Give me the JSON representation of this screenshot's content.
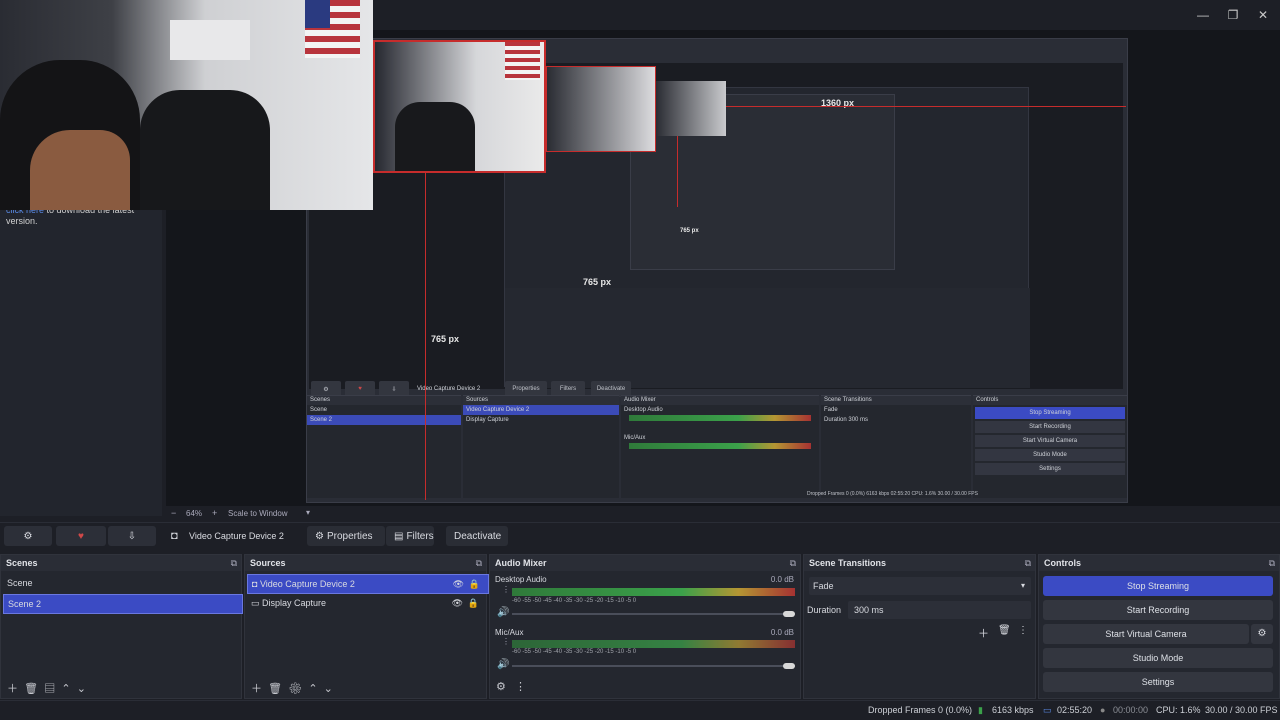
{
  "window": {
    "controls": [
      "—",
      "❐",
      "✕"
    ]
  },
  "update_notice": {
    "link": "click here",
    "text": "to download the latest version."
  },
  "nested": {
    "label_top": "1360 px",
    "label_left": "765 px",
    "label_inner": "765 px",
    "label_inner2": "765 px",
    "source_name": "Video Capture Device 2",
    "toolbar": {
      "properties": "Properties",
      "filters": "Filters",
      "deactivate": "Deactivate"
    },
    "zoom": "64%",
    "scale": "Scale to Window",
    "docks": {
      "scenes": {
        "title": "Scenes",
        "items": [
          "Scene",
          "Scene 2"
        ]
      },
      "sources": {
        "title": "Sources",
        "items": [
          "Video Capture Device 2",
          "Display Capture"
        ]
      },
      "mixer": {
        "title": "Audio Mixer",
        "ch1": "Desktop Audio",
        "ch2": "Mic/Aux"
      },
      "transitions": {
        "title": "Scene Transitions",
        "mode": "Fade",
        "duration_label": "Duration",
        "duration": "300 ms"
      },
      "controls": {
        "title": "Controls",
        "buttons": [
          "Stop Streaming",
          "Start Recording",
          "Start Virtual Camera",
          "Studio Mode",
          "Settings"
        ]
      }
    },
    "status": "Dropped Frames 0 (0.0%)   6163 kbps   02:55:20   CPU: 1.6%   30.00 / 30.00 FPS"
  },
  "zoombar": {
    "minus": "−",
    "zoom": "64%",
    "plus": "+",
    "scale": "Scale to Window"
  },
  "source_toolbar": {
    "source_name": "Video Capture Device 2",
    "properties": "Properties",
    "filters": "Filters",
    "deactivate": "Deactivate"
  },
  "scenes": {
    "title": "Scenes",
    "items": [
      "Scene",
      "Scene 2"
    ],
    "selected": 1
  },
  "sources": {
    "title": "Sources",
    "items": [
      "Video Capture Device 2",
      "Display Capture"
    ]
  },
  "mixer": {
    "title": "Audio Mixer",
    "channels": [
      {
        "name": "Desktop Audio",
        "db": "0.0 dB"
      },
      {
        "name": "Mic/Aux",
        "db": "0.0 dB"
      }
    ],
    "ticks": "-60  -55  -50  -45  -40  -35  -30  -25  -20  -15  -10   -5    0"
  },
  "transitions": {
    "title": "Scene Transitions",
    "mode": "Fade",
    "duration_label": "Duration",
    "duration": "300 ms"
  },
  "controls": {
    "title": "Controls",
    "stop_streaming": "Stop Streaming",
    "start_recording": "Start Recording",
    "start_virtual_camera": "Start Virtual Camera",
    "studio_mode": "Studio Mode",
    "settings": "Settings"
  },
  "status": {
    "dropped": "Dropped Frames 0 (0.0%)",
    "bitrate": "6163 kbps",
    "stream_time": "02:55:20",
    "rec_time": "00:00:00",
    "cpu": "CPU: 1.6%",
    "fps": "30.00 / 30.00 FPS"
  },
  "colors": {
    "accent": "#3b4bc4",
    "guide": "#c62c2c"
  }
}
